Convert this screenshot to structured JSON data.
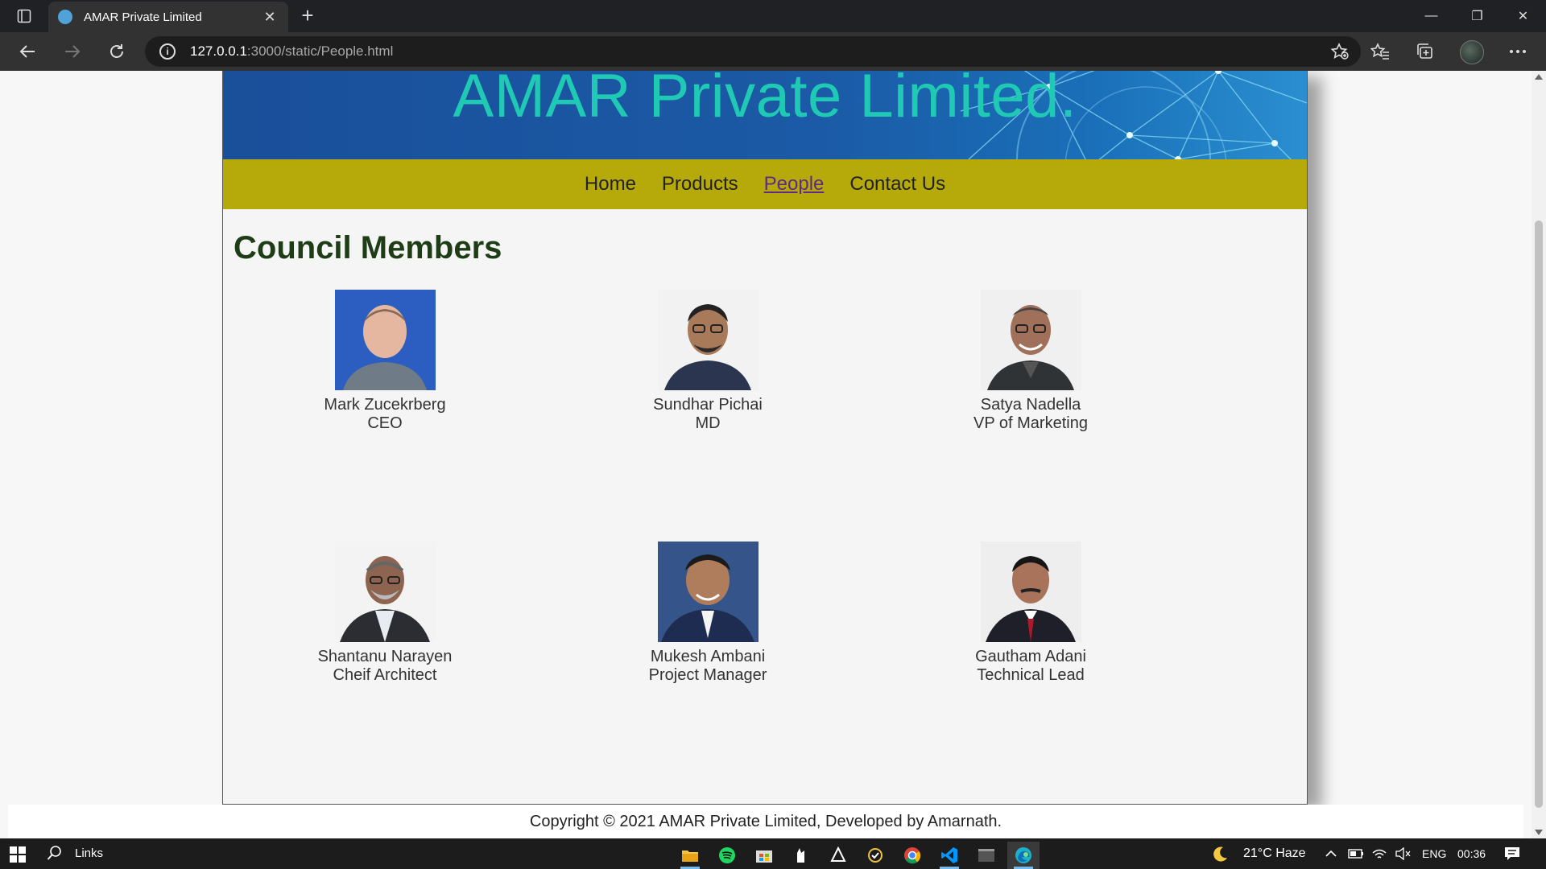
{
  "browser": {
    "tab_title": "AMAR Private Limited",
    "url_host": "127.0.0.1",
    "url_rest": ":3000/static/People.html"
  },
  "site": {
    "brand": "AMAR Private Limited.",
    "nav": {
      "home": "Home",
      "products": "Products",
      "people": "People",
      "contact": "Contact Us"
    },
    "section_title": "Council Members",
    "members": [
      {
        "name": "Mark Zucekrberg",
        "role": "CEO"
      },
      {
        "name": "Sundhar Pichai",
        "role": "MD"
      },
      {
        "name": "Satya Nadella",
        "role": "VP of Marketing"
      },
      {
        "name": "Shantanu Narayen",
        "role": "Cheif Architect"
      },
      {
        "name": "Mukesh Ambani",
        "role": "Project Manager"
      },
      {
        "name": "Gautham Adani",
        "role": "Technical Lead"
      }
    ],
    "footer": "Copyright © 2021 AMAR Private Limited, Developed by Amarnath."
  },
  "taskbar": {
    "search_label": "Links",
    "weather": "21°C  Haze",
    "language": "ENG",
    "time": "00:36"
  },
  "colors": {
    "banner_title": "#1fc9b4",
    "navbar": "#b6a90a",
    "active_link": "#5e2a87",
    "section_title": "#1e3d16"
  }
}
